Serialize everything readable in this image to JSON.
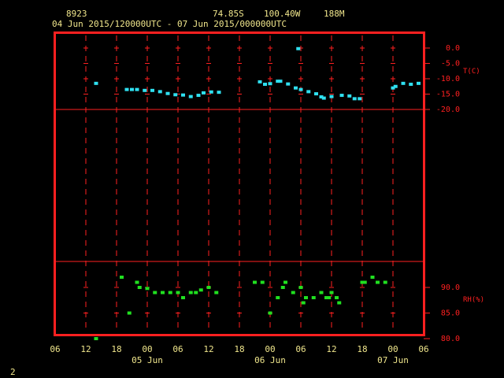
{
  "header": {
    "station_id": "8923",
    "latitude": "74.85S",
    "longitude": "100.40W",
    "elevation": "188M",
    "period": "04 Jun 2015/120000UTC - 07 Jun 2015/000000UTC"
  },
  "footer": {
    "page_number": "2"
  },
  "chart_data": [
    {
      "type": "scatter",
      "title": "",
      "ylabel": "T(C)",
      "xlabel": "",
      "x_unit": "hours since 04 Jun 2015 06 UTC",
      "xlim": [
        0,
        72
      ],
      "ylim": [
        -20,
        0
      ],
      "yticks": [
        0.0,
        -5.0,
        -10.0,
        -15.0,
        -20.0
      ],
      "grid": true,
      "color": "#2fe0f0",
      "series": [
        {
          "name": "T",
          "points": [
            [
              8,
              -11.5
            ],
            [
              14,
              -13.5
            ],
            [
              15,
              -13.5
            ],
            [
              16,
              -13.5
            ],
            [
              17.5,
              -13.8
            ],
            [
              19,
              -13.8
            ],
            [
              20.5,
              -14.2
            ],
            [
              22,
              -14.8
            ],
            [
              23.5,
              -15.2
            ],
            [
              25,
              -15.3
            ],
            [
              26.5,
              -15.8
            ],
            [
              28,
              -15.4
            ],
            [
              29,
              -14.6
            ],
            [
              30.5,
              -14.3
            ],
            [
              32,
              -14.4
            ],
            [
              40,
              -11.0
            ],
            [
              41,
              -11.8
            ],
            [
              42,
              -11.6
            ],
            [
              43.5,
              -10.8
            ],
            [
              44,
              -10.8
            ],
            [
              45.5,
              -11.7
            ],
            [
              47,
              -13.0
            ],
            [
              47.5,
              -0.2
            ],
            [
              48,
              -13.5
            ],
            [
              49.5,
              -14.2
            ],
            [
              51,
              -14.9
            ],
            [
              52,
              -15.9
            ],
            [
              52.5,
              -16.3
            ],
            [
              54,
              -15.8
            ],
            [
              56,
              -15.4
            ],
            [
              57.5,
              -15.6
            ],
            [
              58.5,
              -16.5
            ],
            [
              59.5,
              -16.5
            ],
            [
              66,
              -13.0
            ],
            [
              66.5,
              -12.5
            ],
            [
              68,
              -11.5
            ],
            [
              69.5,
              -11.8
            ],
            [
              71,
              -11.5
            ]
          ]
        }
      ]
    },
    {
      "type": "scatter",
      "title": "",
      "ylabel": "RH(%)",
      "xlabel": "",
      "x_unit": "hours since 04 Jun 2015 06 UTC",
      "xlim": [
        0,
        72
      ],
      "ylim": [
        80,
        95
      ],
      "yticks": [
        90.0,
        85.0,
        80.0
      ],
      "xticks": [
        "06",
        "12",
        "18",
        "00",
        "06",
        "12",
        "18",
        "00",
        "06",
        "12",
        "18",
        "00",
        "06"
      ],
      "date_labels": [
        "05 Jun",
        "06 Jun",
        "07 Jun"
      ],
      "grid": true,
      "color": "#20e020",
      "series": [
        {
          "name": "RH",
          "points": [
            [
              8,
              80.0
            ],
            [
              13,
              92.0
            ],
            [
              14.5,
              85.0
            ],
            [
              16,
              91.0
            ],
            [
              16.5,
              90.0
            ],
            [
              18,
              89.8
            ],
            [
              19.5,
              89.0
            ],
            [
              21,
              89.0
            ],
            [
              22.5,
              89.0
            ],
            [
              24,
              89.0
            ],
            [
              25,
              88.0
            ],
            [
              26.5,
              89.0
            ],
            [
              27.5,
              89.0
            ],
            [
              28.5,
              89.5
            ],
            [
              30,
              90.0
            ],
            [
              31.5,
              89.0
            ],
            [
              39,
              91.0
            ],
            [
              40.5,
              91.0
            ],
            [
              42,
              85.0
            ],
            [
              43.5,
              88.0
            ],
            [
              44.5,
              90.0
            ],
            [
              45,
              91.0
            ],
            [
              46.5,
              89.0
            ],
            [
              48,
              90.0
            ],
            [
              48.5,
              87.0
            ],
            [
              49,
              88.0
            ],
            [
              50.5,
              88.0
            ],
            [
              52,
              89.0
            ],
            [
              53,
              88.0
            ],
            [
              53.5,
              88.0
            ],
            [
              54,
              89.0
            ],
            [
              55,
              88.0
            ],
            [
              55.5,
              87.0
            ],
            [
              60,
              91.0
            ],
            [
              60.5,
              91.0
            ],
            [
              62,
              92.0
            ],
            [
              63,
              91.0
            ],
            [
              64.5,
              91.0
            ]
          ]
        }
      ]
    }
  ]
}
